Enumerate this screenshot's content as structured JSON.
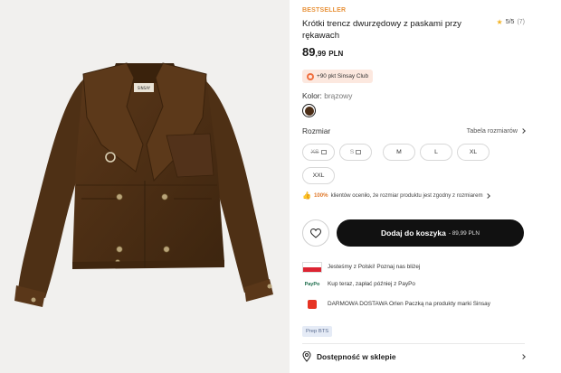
{
  "product": {
    "badge": "BESTSELLER",
    "title": "Krótki trencz dwurzędowy z paskami przy rękawach",
    "rating": {
      "value": "5/5",
      "count": "(7)",
      "icon": "star-icon",
      "color": "#f3b324"
    },
    "price": {
      "main": "89",
      "decimal": ",99",
      "currency": "PLN"
    },
    "club": "+90 pkt Sinsay Club",
    "color": {
      "label": "Kolor:",
      "value": "brązowy",
      "swatch": "#4b2d16"
    },
    "size_label": "Rozmiar",
    "size_chart": "Tabela rozmiarów",
    "sizes": [
      {
        "label": "XS",
        "available": false
      },
      {
        "label": "S",
        "available": false
      },
      {
        "label": "M",
        "available": true
      },
      {
        "label": "L",
        "available": true
      },
      {
        "label": "XL",
        "available": true
      },
      {
        "label": "XXL",
        "available": true
      }
    ],
    "fit_note": {
      "pct": "100%",
      "text": "klientów oceniło, że rozmiar produktu jest zgodny z rozmiarem"
    },
    "add_to_cart": {
      "label": "Dodaj do koszyka",
      "price": "- 89,99 PLN"
    },
    "promos": [
      {
        "icon": "poland-flag-icon",
        "text": "Jesteśmy z Polski! Poznaj nas bliżej"
      },
      {
        "icon": "paypo-icon",
        "brand": "PayPo",
        "text": "Kup teraz, zapłać później z PayPo"
      },
      {
        "icon": "orlen-paczka-icon",
        "text": "DARMOWA DOSTAWA Orlen Paczką na produkty marki Sinsay"
      }
    ],
    "tag": "Prep BTS",
    "store": "Dostępność w sklepie",
    "jacket_label": "SINSAY",
    "accent": "#e8923a",
    "button_color": "#111111"
  }
}
